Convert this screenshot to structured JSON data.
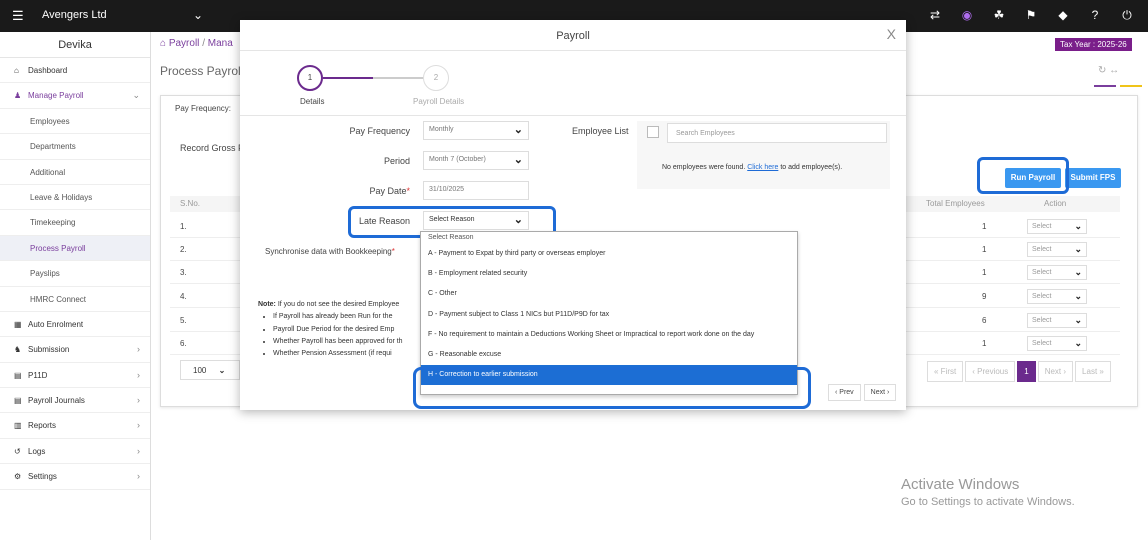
{
  "topbar": {
    "company": "Avengers Ltd",
    "icons": [
      "swap-icon",
      "app-logo-icon",
      "share-icon",
      "announce-icon",
      "tag-icon",
      "help-icon",
      "power-icon"
    ]
  },
  "sidebar": {
    "user": "Devika",
    "items": [
      {
        "label": "Dashboard",
        "icon": "home-icon"
      },
      {
        "label": "Manage Payroll",
        "icon": "user-icon"
      },
      {
        "label": "Employees"
      },
      {
        "label": "Departments"
      },
      {
        "label": "Additional"
      },
      {
        "label": "Leave & Holidays"
      },
      {
        "label": "Timekeeping"
      },
      {
        "label": "Process Payroll"
      },
      {
        "label": "Payslips"
      },
      {
        "label": "HMRC Connect"
      },
      {
        "label": "Auto Enrolment",
        "icon": "grid-icon"
      },
      {
        "label": "Submission",
        "icon": "group-icon"
      },
      {
        "label": "P11D",
        "icon": "doc-icon"
      },
      {
        "label": "Payroll Journals",
        "icon": "journal-icon"
      },
      {
        "label": "Reports",
        "icon": "report-icon"
      },
      {
        "label": "Logs",
        "icon": "history-icon"
      },
      {
        "label": "Settings",
        "icon": "gear-icon"
      }
    ]
  },
  "breadcrumb": {
    "first": "Payroll",
    "sep": "/",
    "second": "Mana"
  },
  "tax_year": "Tax Year : 2025-26",
  "page_title": "Process Payroll",
  "background": {
    "pay_frequency_label": "Pay Frequency:",
    "record_label": "Record Gross Pa",
    "run_payroll": "Run Payroll",
    "submit_fps": "Submit FPS",
    "headers": {
      "sno": "S.No.",
      "total": "Total Employees",
      "action": "Action"
    },
    "rows": [
      {
        "sno": "1.",
        "total": "1",
        "action": "Select"
      },
      {
        "sno": "2.",
        "total": "1",
        "action": "Select"
      },
      {
        "sno": "3.",
        "total": "1",
        "action": "Select"
      },
      {
        "sno": "4.",
        "total": "9",
        "action": "Select"
      },
      {
        "sno": "5.",
        "total": "6",
        "action": "Select"
      },
      {
        "sno": "6.",
        "total": "1",
        "action": "Select"
      }
    ],
    "page_size": "100",
    "pager": {
      "first": "« First",
      "prev": "‹ Previous",
      "current": "1",
      "next": "Next ›",
      "last": "Last »"
    }
  },
  "modal": {
    "title": "Payroll",
    "close": "X",
    "steps": [
      {
        "num": "1",
        "label": "Details"
      },
      {
        "num": "2",
        "label": "Payroll Details"
      }
    ],
    "fields": {
      "pay_frequency": {
        "label": "Pay Frequency",
        "value": "Monthly"
      },
      "period": {
        "label": "Period",
        "value": "Month 7 (October)"
      },
      "pay_date": {
        "label": "Pay Date",
        "required": "*",
        "value": "31/10/2025"
      },
      "late_reason": {
        "label": "Late Reason",
        "value": "Select Reason"
      }
    },
    "employee_list": {
      "label": "Employee List",
      "search_placeholder": "Search Employees",
      "empty_text": "No employees were found.",
      "link_text": "Click here",
      "after_link": "to add employee(s)."
    },
    "sync_label": "Synchronise data with Bookkeeping",
    "sync_required": "*",
    "note": {
      "bold": "Note:",
      "text": "If you do not see the desired Employee",
      "bullets": [
        "If Payroll has already been Run for the",
        "Payroll Due Period for the desired Emp",
        "Whether Payroll has been approved for th",
        "Whether Pension Assessment (if requi"
      ]
    },
    "nav": {
      "prev": "‹ Prev",
      "next": "Next ›"
    },
    "late_reason_options": [
      "Select Reason",
      "A - Payment to Expat by third party or overseas employer",
      "B - Employment related security",
      "C - Other",
      "D - Payment subject to Class 1 NICs but P11D/P9D for tax",
      "F - No requirement to maintain a Deductions Working Sheet or Impractical to report work done on the day",
      "G - Reasonable excuse",
      "H - Correction to earlier submission"
    ],
    "highlighted_option": "H - Correction to earlier submission"
  },
  "watermark": {
    "line1": "Activate Windows",
    "line2": "Go to Settings to activate Windows."
  },
  "colors": {
    "brand_purple": "#6b2a8d",
    "accent_blue": "#3a98f0",
    "selection_blue": "#1c6ed4",
    "highlight_outline": "#1e6bd6"
  }
}
